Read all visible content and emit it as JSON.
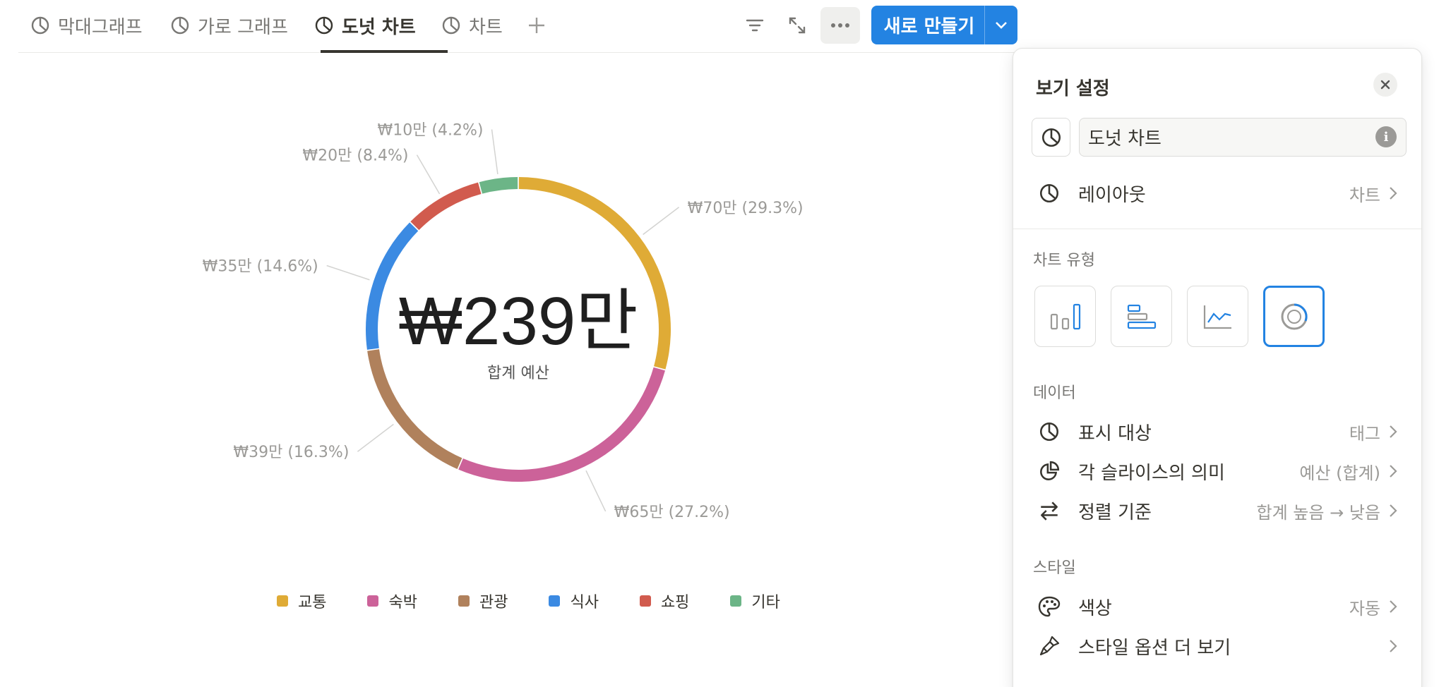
{
  "tabs": [
    {
      "label": "막대그래프",
      "icon": "pie-icon"
    },
    {
      "label": "가로 그래프",
      "icon": "pie-icon"
    },
    {
      "label": "도넛 차트",
      "icon": "pie-icon",
      "active": true
    },
    {
      "label": "차트",
      "icon": "pie-icon"
    }
  ],
  "toolbar": {
    "new_label": "새로 만들기"
  },
  "chart": {
    "center_value": "₩239만",
    "center_caption": "합계 예산"
  },
  "chart_data": {
    "type": "pie",
    "donut": true,
    "categories": [
      "교통",
      "숙박",
      "관광",
      "식사",
      "쇼핑",
      "기타"
    ],
    "values": [
      70,
      65,
      39,
      35,
      20,
      10
    ],
    "labels": [
      "₩70만 (29.3%)",
      "₩65만 (27.2%)",
      "₩39만 (16.3%)",
      "₩35만 (14.6%)",
      "₩20만 (8.4%)",
      "₩10만 (4.2%)"
    ],
    "colors": [
      "#dfab36",
      "#cc6299",
      "#b0815c",
      "#3b8ae2",
      "#d15b4e",
      "#6cb587"
    ],
    "total_label": "₩239만",
    "total_caption": "합계 예산",
    "legend": [
      "교통",
      "숙박",
      "관광",
      "식사",
      "쇼핑",
      "기타"
    ],
    "legend_position": "bottom"
  },
  "panel": {
    "title": "보기 설정",
    "name_value": "도넛 차트",
    "layout": {
      "label": "레이아웃",
      "value": "차트"
    },
    "chart_type_section": "차트 유형",
    "chart_types": [
      "bar-chart-icon",
      "horizontal-bar-icon",
      "line-chart-icon",
      "donut-chart-icon"
    ],
    "data_section": "데이터",
    "show_target": {
      "label": "표시 대상",
      "value": "태그"
    },
    "slice_meaning": {
      "label": "각 슬라이스의 의미",
      "value": "예산 (합계)"
    },
    "sort_by": {
      "label": "정렬 기준",
      "value": "합계 높음 → 낮음"
    },
    "style_section": "스타일",
    "color": {
      "label": "색상",
      "value": "자동"
    },
    "more_style": {
      "label": "스타일 옵션 더 보기"
    }
  },
  "accent": "#2383e2"
}
